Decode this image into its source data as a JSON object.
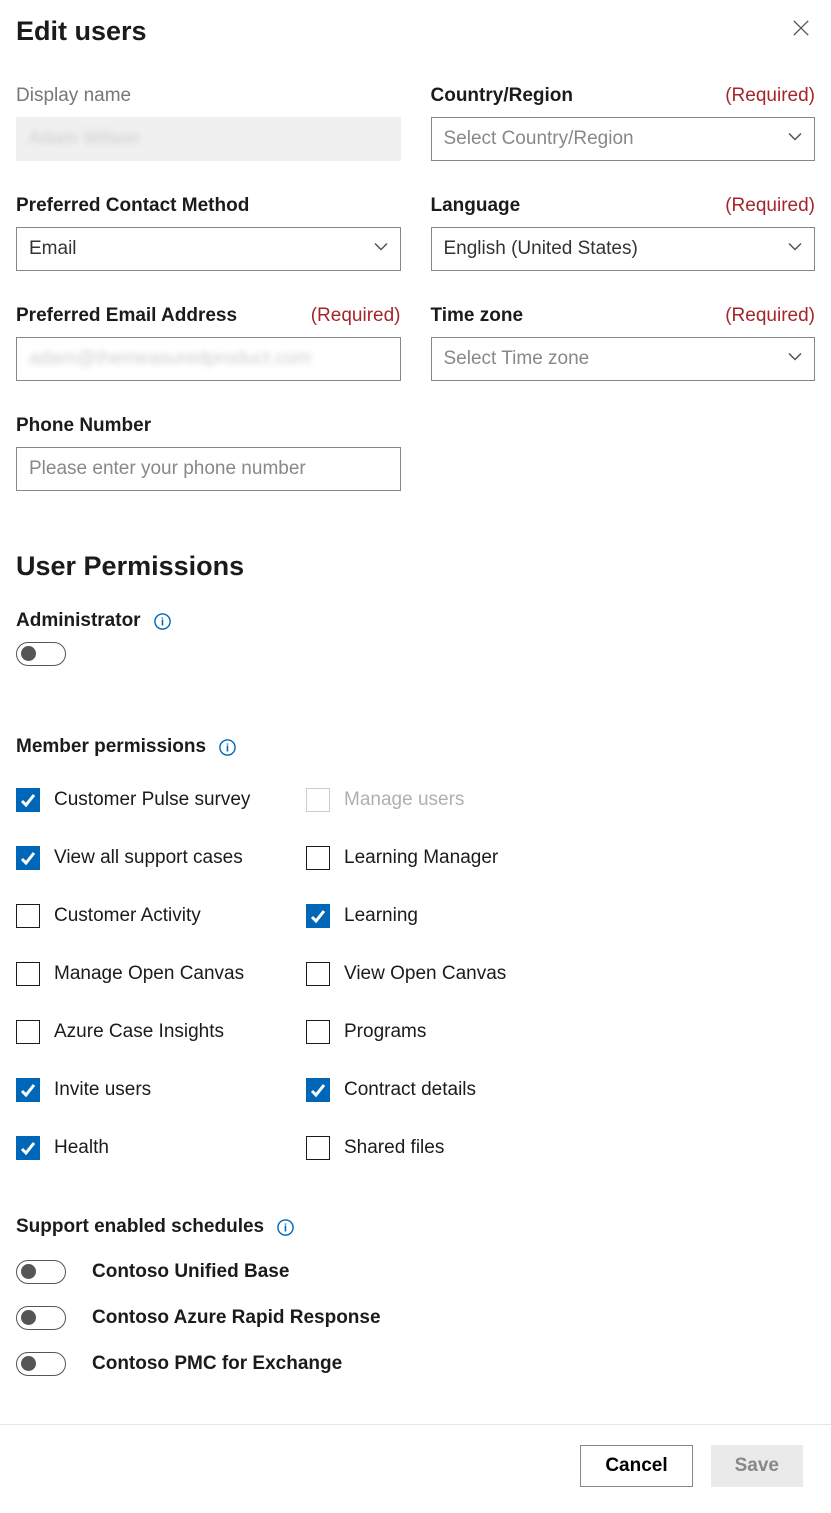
{
  "header": {
    "title": "Edit users"
  },
  "labels": {
    "required": "(Required)"
  },
  "fields": {
    "display_name": {
      "label": "Display name",
      "value": "Adam Wilson"
    },
    "country": {
      "label": "Country/Region",
      "placeholder": "Select Country/Region"
    },
    "contact_method": {
      "label": "Preferred Contact Method",
      "value": "Email"
    },
    "language": {
      "label": "Language",
      "value": "English (United States)"
    },
    "email": {
      "label": "Preferred Email Address",
      "value": "adam@themeasuredproduct.com"
    },
    "timezone": {
      "label": "Time zone",
      "placeholder": "Select Time zone"
    },
    "phone": {
      "label": "Phone Number",
      "placeholder": "Please enter your phone number"
    }
  },
  "permissions": {
    "section_title": "User Permissions",
    "admin_label": "Administrator",
    "admin_enabled": false,
    "member_label": "Member permissions",
    "items": [
      {
        "label": "Customer Pulse survey",
        "checked": true,
        "disabled": false
      },
      {
        "label": "Manage users",
        "checked": false,
        "disabled": true
      },
      {
        "label": "View all support cases",
        "checked": true,
        "disabled": false
      },
      {
        "label": "Learning Manager",
        "checked": false,
        "disabled": false
      },
      {
        "label": "Customer Activity",
        "checked": false,
        "disabled": false
      },
      {
        "label": "Learning",
        "checked": true,
        "disabled": false
      },
      {
        "label": "Manage Open Canvas",
        "checked": false,
        "disabled": false
      },
      {
        "label": "View Open Canvas",
        "checked": false,
        "disabled": false
      },
      {
        "label": "Azure Case Insights",
        "checked": false,
        "disabled": false
      },
      {
        "label": "Programs",
        "checked": false,
        "disabled": false
      },
      {
        "label": "Invite users",
        "checked": true,
        "disabled": false
      },
      {
        "label": "Contract details",
        "checked": true,
        "disabled": false
      },
      {
        "label": "Health",
        "checked": true,
        "disabled": false
      },
      {
        "label": "Shared files",
        "checked": false,
        "disabled": false
      }
    ]
  },
  "schedules": {
    "label": "Support enabled schedules",
    "items": [
      {
        "label": "Contoso Unified Base",
        "enabled": false
      },
      {
        "label": "Contoso Azure Rapid Response",
        "enabled": false
      },
      {
        "label": "Contoso PMC for Exchange",
        "enabled": false
      }
    ]
  },
  "footer": {
    "cancel": "Cancel",
    "save": "Save"
  }
}
